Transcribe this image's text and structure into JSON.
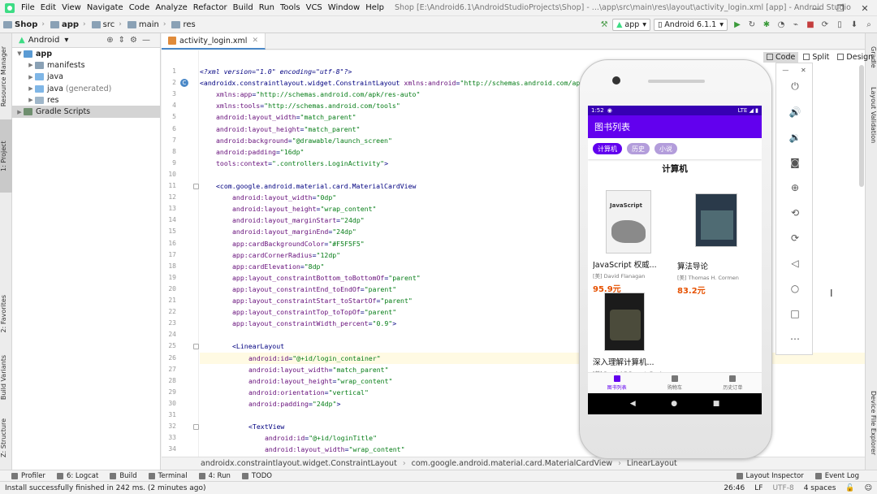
{
  "menu": {
    "items": [
      "File",
      "Edit",
      "View",
      "Navigate",
      "Code",
      "Analyze",
      "Refactor",
      "Build",
      "Run",
      "Tools",
      "VCS",
      "Window",
      "Help"
    ],
    "window_title": "Shop [E:\\Android6.1\\AndroidStudioProjects\\Shop] - ...\\app\\src\\main\\res\\layout\\activity_login.xml [app] - Android Studio"
  },
  "nav": {
    "crumbs": [
      "Shop",
      "app",
      "src",
      "main",
      "res"
    ],
    "run_config": "app",
    "device": "Android 6.1.1"
  },
  "project_panel": {
    "view_label": "Android",
    "tree": [
      {
        "label": "app",
        "kind": "mod",
        "arrow": "▼",
        "indent": 0
      },
      {
        "label": "manifests",
        "kind": "folder",
        "arrow": "▶",
        "indent": 1
      },
      {
        "label": "java",
        "kind": "java",
        "arrow": "▶",
        "indent": 1
      },
      {
        "label": "java",
        "suffix": "(generated)",
        "kind": "java",
        "arrow": "▶",
        "indent": 1
      },
      {
        "label": "res",
        "kind": "res",
        "arrow": "▶",
        "indent": 1
      },
      {
        "label": "Gradle Scripts",
        "kind": "gradle",
        "arrow": "▶",
        "indent": 0
      }
    ]
  },
  "left_tabs": [
    "Resource Manager",
    "1: Project",
    "2: Favorites",
    "Build Variants",
    "Z: Structure"
  ],
  "right_tabs": [
    "Gradle",
    "Layout Validation",
    "Device File Explorer"
  ],
  "editor": {
    "tab_label": "activity_login.xml",
    "view_modes": [
      "Code",
      "Split",
      "Design"
    ],
    "current_line": 26,
    "lines": [
      {
        "n": 1,
        "indent": 0,
        "parts": [
          [
            "pi",
            "<?xml version=\"1.0\" encoding=\"utf-8\"?>"
          ]
        ]
      },
      {
        "n": 2,
        "indent": 0,
        "parts": [
          [
            "tag",
            "<androidx.constraintlayout.widget.ConstraintLayout "
          ],
          [
            "attr",
            "xmlns:android"
          ],
          [
            "tag",
            "="
          ],
          [
            "val",
            "\"http://schemas.android.com/apk/res/android\""
          ]
        ]
      },
      {
        "n": 3,
        "indent": 1,
        "parts": [
          [
            "attr",
            "xmlns:app"
          ],
          [
            "tag",
            "="
          ],
          [
            "val",
            "\"http://schemas.android.com/apk/res-auto\""
          ]
        ]
      },
      {
        "n": 4,
        "indent": 1,
        "parts": [
          [
            "attr",
            "xmlns:tools"
          ],
          [
            "tag",
            "="
          ],
          [
            "val",
            "\"http://schemas.android.com/tools\""
          ]
        ]
      },
      {
        "n": 5,
        "indent": 1,
        "parts": [
          [
            "attr",
            "android:layout_width"
          ],
          [
            "tag",
            "="
          ],
          [
            "val",
            "\"match_parent\""
          ]
        ]
      },
      {
        "n": 6,
        "indent": 1,
        "parts": [
          [
            "attr",
            "android:layout_height"
          ],
          [
            "tag",
            "="
          ],
          [
            "val",
            "\"match_parent\""
          ]
        ]
      },
      {
        "n": 7,
        "indent": 1,
        "parts": [
          [
            "attr",
            "android:background"
          ],
          [
            "tag",
            "="
          ],
          [
            "val",
            "\"@drawable/launch_screen\""
          ]
        ]
      },
      {
        "n": 8,
        "indent": 1,
        "parts": [
          [
            "attr",
            "android:padding"
          ],
          [
            "tag",
            "="
          ],
          [
            "val",
            "\"16dp\""
          ]
        ]
      },
      {
        "n": 9,
        "indent": 1,
        "parts": [
          [
            "attr",
            "tools:context"
          ],
          [
            "tag",
            "="
          ],
          [
            "val",
            "\".controllers.LoginActivity\""
          ],
          [
            "tag",
            ">"
          ]
        ]
      },
      {
        "n": 10,
        "indent": 0,
        "parts": []
      },
      {
        "n": 11,
        "indent": 1,
        "parts": [
          [
            "tag",
            "<com.google.android.material.card.MaterialCardView"
          ]
        ]
      },
      {
        "n": 12,
        "indent": 2,
        "parts": [
          [
            "attr",
            "android:layout_width"
          ],
          [
            "tag",
            "="
          ],
          [
            "val",
            "\"0dp\""
          ]
        ]
      },
      {
        "n": 13,
        "indent": 2,
        "parts": [
          [
            "attr",
            "android:layout_height"
          ],
          [
            "tag",
            "="
          ],
          [
            "val",
            "\"wrap_content\""
          ]
        ]
      },
      {
        "n": 14,
        "indent": 2,
        "parts": [
          [
            "attr",
            "android:layout_marginStart"
          ],
          [
            "tag",
            "="
          ],
          [
            "val",
            "\"24dp\""
          ]
        ]
      },
      {
        "n": 15,
        "indent": 2,
        "parts": [
          [
            "attr",
            "android:layout_marginEnd"
          ],
          [
            "tag",
            "="
          ],
          [
            "val",
            "\"24dp\""
          ]
        ]
      },
      {
        "n": 16,
        "indent": 2,
        "parts": [
          [
            "attr",
            "app:cardBackgroundColor"
          ],
          [
            "tag",
            "="
          ],
          [
            "val",
            "\"#F5F5F5\""
          ]
        ]
      },
      {
        "n": 17,
        "indent": 2,
        "parts": [
          [
            "attr",
            "app:cardCornerRadius"
          ],
          [
            "tag",
            "="
          ],
          [
            "val",
            "\"12dp\""
          ]
        ]
      },
      {
        "n": 18,
        "indent": 2,
        "parts": [
          [
            "attr",
            "app:cardElevation"
          ],
          [
            "tag",
            "="
          ],
          [
            "val",
            "\"8dp\""
          ]
        ]
      },
      {
        "n": 19,
        "indent": 2,
        "parts": [
          [
            "attr",
            "app:layout_constraintBottom_toBottomOf"
          ],
          [
            "tag",
            "="
          ],
          [
            "val",
            "\"parent\""
          ]
        ]
      },
      {
        "n": 20,
        "indent": 2,
        "parts": [
          [
            "attr",
            "app:layout_constraintEnd_toEndOf"
          ],
          [
            "tag",
            "="
          ],
          [
            "val",
            "\"parent\""
          ]
        ]
      },
      {
        "n": 21,
        "indent": 2,
        "parts": [
          [
            "attr",
            "app:layout_constraintStart_toStartOf"
          ],
          [
            "tag",
            "="
          ],
          [
            "val",
            "\"parent\""
          ]
        ]
      },
      {
        "n": 22,
        "indent": 2,
        "parts": [
          [
            "attr",
            "app:layout_constraintTop_toTopOf"
          ],
          [
            "tag",
            "="
          ],
          [
            "val",
            "\"parent\""
          ]
        ]
      },
      {
        "n": 23,
        "indent": 2,
        "parts": [
          [
            "attr",
            "app:layout_constraintWidth_percent"
          ],
          [
            "tag",
            "="
          ],
          [
            "val",
            "\"0.9\""
          ],
          [
            "tag",
            ">"
          ]
        ]
      },
      {
        "n": 24,
        "indent": 0,
        "parts": []
      },
      {
        "n": 25,
        "indent": 2,
        "parts": [
          [
            "tag",
            "<LinearLayout"
          ]
        ]
      },
      {
        "n": 26,
        "indent": 3,
        "parts": [
          [
            "attr",
            "android:id"
          ],
          [
            "tag",
            "="
          ],
          [
            "val",
            "\"@+id/login_container\""
          ]
        ]
      },
      {
        "n": 27,
        "indent": 3,
        "parts": [
          [
            "attr",
            "android:layout_width"
          ],
          [
            "tag",
            "="
          ],
          [
            "val",
            "\"match_parent\""
          ]
        ]
      },
      {
        "n": 28,
        "indent": 3,
        "parts": [
          [
            "attr",
            "android:layout_height"
          ],
          [
            "tag",
            "="
          ],
          [
            "val",
            "\"wrap_content\""
          ]
        ]
      },
      {
        "n": 29,
        "indent": 3,
        "parts": [
          [
            "attr",
            "android:orientation"
          ],
          [
            "tag",
            "="
          ],
          [
            "val",
            "\"vertical\""
          ]
        ]
      },
      {
        "n": 30,
        "indent": 3,
        "parts": [
          [
            "attr",
            "android:padding"
          ],
          [
            "tag",
            "="
          ],
          [
            "val",
            "\"24dp\""
          ],
          [
            "tag",
            ">"
          ]
        ]
      },
      {
        "n": 31,
        "indent": 0,
        "parts": []
      },
      {
        "n": 32,
        "indent": 3,
        "parts": [
          [
            "tag",
            "<TextView"
          ]
        ]
      },
      {
        "n": 33,
        "indent": 4,
        "parts": [
          [
            "attr",
            "android:id"
          ],
          [
            "tag",
            "="
          ],
          [
            "val",
            "\"@+id/loginTitle\""
          ]
        ]
      },
      {
        "n": 34,
        "indent": 4,
        "parts": [
          [
            "attr",
            "android:layout_width"
          ],
          [
            "tag",
            "="
          ],
          [
            "val",
            "\"wrap_content\""
          ]
        ]
      }
    ],
    "breadcrumb": [
      "androidx.constraintlayout.widget.ConstraintLayout",
      "com.google.android.material.card.MaterialCardView",
      "LinearLayout"
    ]
  },
  "emulator": {
    "status_time": "1:52",
    "status_right": "LTE ◢ ▮",
    "app_title": "图书列表",
    "chips": [
      "计算机",
      "历史",
      "小说"
    ],
    "active_chip": 0,
    "category_title": "计算机",
    "books": [
      {
        "title": "JavaScript 权威...",
        "author": "[美] David Flanagan",
        "price": "95.9元",
        "cover": "js"
      },
      {
        "title": "算法导论",
        "author": "[美] Thomas H. Cormen",
        "price": "83.2元",
        "cover": "algo"
      },
      {
        "title": "深入理解计算机...",
        "author": "[美] Randal E.Bryant, Davi...",
        "price": "",
        "cover": "cs"
      }
    ],
    "bottom_nav": [
      "图书列表",
      "购物车",
      "历史订单"
    ],
    "active_nav": 0,
    "sys_nav": [
      "◀",
      "●",
      "■"
    ],
    "side_controls": [
      "power-icon",
      "volume-up-icon",
      "volume-down-icon",
      "camera-icon",
      "zoom-icon",
      "rotate-left-icon",
      "rotate-right-icon",
      "back-icon",
      "home-icon",
      "overview-icon",
      "more-icon"
    ]
  },
  "bottom_tools": {
    "left": [
      "Profiler",
      "6: Logcat",
      "Build",
      "Terminal",
      "4: Run",
      "TODO"
    ],
    "right": [
      "Layout Inspector",
      "Event Log"
    ]
  },
  "status": {
    "message": "Install successfully finished in 242 ms. (2 minutes ago)",
    "position": "26:46",
    "line_sep": "LF",
    "encoding": "UTF-8",
    "indent": "4 spaces"
  },
  "colors": {
    "accent": "#6200ee",
    "status_bar": "#3700b3",
    "price": "#e65100"
  }
}
